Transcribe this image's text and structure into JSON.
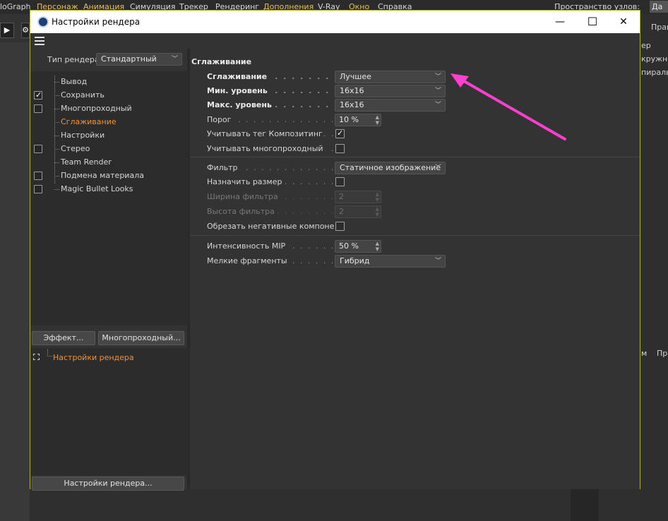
{
  "bg_menu": {
    "items": [
      {
        "label": "loGraph",
        "color": "white"
      },
      {
        "label": "Персонаж",
        "color": "yellow"
      },
      {
        "label": "Анимация",
        "color": "yellow"
      },
      {
        "label": "Симуляция",
        "color": "white"
      },
      {
        "label": "Трекер",
        "color": "white"
      },
      {
        "label": "Рендеринг",
        "color": "white"
      },
      {
        "label": "Дополнения",
        "color": "yellow"
      },
      {
        "label": "V-Ray",
        "color": "white"
      },
      {
        "label": "Окно",
        "color": "yellow"
      },
      {
        "label": "Справка",
        "color": "white"
      }
    ],
    "right_label": "Пространство узлов:",
    "right_value": "Да"
  },
  "bg_right_panel": {
    "items": [
      "Прав",
      "ер",
      "кружно",
      "пираль",
      "м",
      "Пра"
    ]
  },
  "dialog": {
    "title": "Настройки рендера",
    "minimize": "—",
    "maximize": "☐",
    "close": "✕",
    "render_type_label": "Тип рендера",
    "render_type_value": "Стандартный",
    "tree": [
      {
        "label": "Вывод",
        "checkbox": false,
        "checked": false,
        "active": false
      },
      {
        "label": "Сохранить",
        "checkbox": true,
        "checked": true,
        "active": false
      },
      {
        "label": "Многопроходный",
        "checkbox": true,
        "checked": false,
        "active": false
      },
      {
        "label": "Сглаживание",
        "checkbox": false,
        "checked": false,
        "active": true
      },
      {
        "label": "Настройки",
        "checkbox": false,
        "checked": false,
        "active": false
      },
      {
        "label": "Стерео",
        "checkbox": true,
        "checked": false,
        "active": false
      },
      {
        "label": "Team Render",
        "checkbox": false,
        "checked": false,
        "active": false
      },
      {
        "label": "Подмена материала",
        "checkbox": true,
        "checked": false,
        "active": false
      },
      {
        "label": "Magic Bullet Looks",
        "checkbox": true,
        "checked": false,
        "active": false
      }
    ],
    "effect_button": "Эффект...",
    "multipass_button": "Многопроходный...",
    "preset_item": "Настройки рендера",
    "bottom_button": "Настройки рендера..."
  },
  "section": {
    "title": "Сглаживание",
    "antialiasing_label": "Сглаживание",
    "antialiasing_value": "Лучшее",
    "min_level_label": "Мин. уровень",
    "min_level_value": "16x16",
    "max_level_label": "Макс. уровень",
    "max_level_value": "16x16",
    "threshold_label": "Порог",
    "threshold_value": "10 %",
    "composite_tag_label": "Учитывать тег Композитинг",
    "composite_tag_checked": true,
    "multipass_label": "Учитывать многопроходный",
    "multipass_checked": false,
    "filter_label": "Фильтр",
    "filter_value": "Статичное изображение",
    "custom_size_label": "Назначить размер",
    "custom_size_checked": false,
    "filter_width_label": "Ширина фильтра",
    "filter_width_value": "2",
    "filter_height_label": "Высота фильтра",
    "filter_height_value": "2",
    "clip_negative_label": "Обрезать негативные компоненты",
    "clip_negative_checked": false,
    "mip_label": "Интенсивность MIP",
    "mip_value": "50 %",
    "micro_label": "Мелкие фрагменты",
    "micro_value": "Гибрид"
  },
  "colors": {
    "accent": "#f0923c",
    "arrow": "#ff3fd0",
    "dialog_border": "#b8b400"
  }
}
